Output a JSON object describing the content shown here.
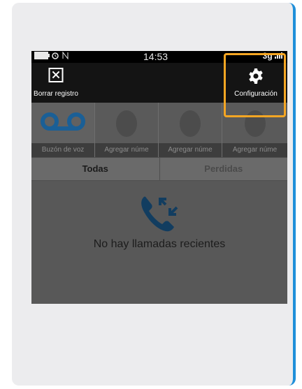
{
  "statusbar": {
    "time": "14:53",
    "network": "3g",
    "icons": [
      "battery-icon",
      "alarm-icon",
      "nfc-icon",
      "signal-icon"
    ]
  },
  "toolbar": {
    "clear_label": "Borrar registro",
    "settings_label": "Configuración"
  },
  "speed_dial": [
    {
      "label": "Buzón de voz",
      "icon": "voicemail-icon"
    },
    {
      "label": "Agregar núme",
      "icon": "contact-silhouette-icon"
    },
    {
      "label": "Agregar núme",
      "icon": "contact-silhouette-icon"
    },
    {
      "label": "Agregar núme",
      "icon": "contact-silhouette-icon"
    }
  ],
  "tabs": [
    {
      "label": "Todas",
      "active": true
    },
    {
      "label": "Perdidas",
      "active": false
    }
  ],
  "empty_state": {
    "message": "No hay llamadas recientes",
    "icon": "call-arrows-icon"
  },
  "colors": {
    "accent": "#1f8fd9",
    "highlight": "#f5a623",
    "voicemail": "#1a73b8"
  }
}
